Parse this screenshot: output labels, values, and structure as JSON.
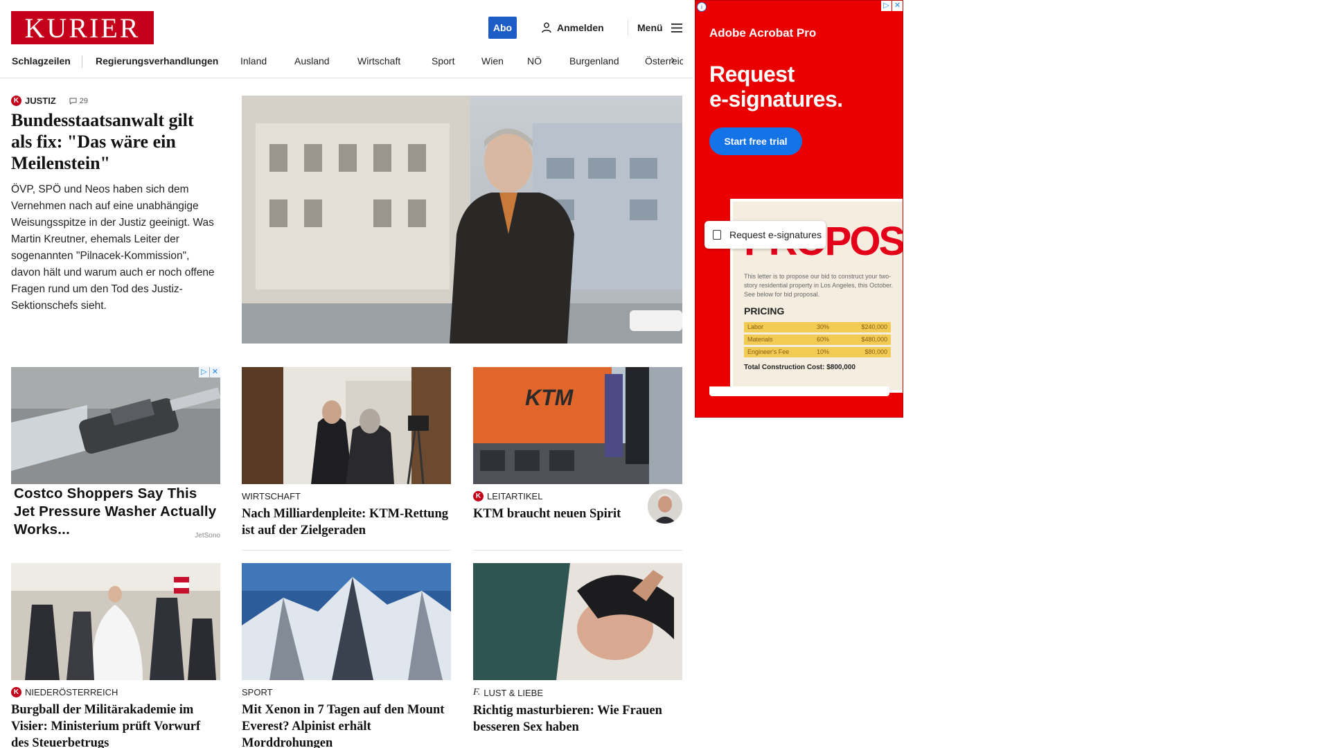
{
  "header": {
    "logo": "KURIER",
    "abo": "Abo",
    "login": "Anmelden",
    "menu": "Menü"
  },
  "nav": [
    "Schlagzeilen",
    "Regierungsverhandlungen",
    "Inland",
    "Ausland",
    "Wirtschaft",
    "Sport",
    "Wien",
    "NÖ",
    "Burgenland",
    "Österreich"
  ],
  "lead": {
    "category": "JUSTIZ",
    "comments": "29",
    "title": "Bundesstaatsanwalt gilt als fix: \"Das wäre ein Meilenstein\"",
    "text": "ÖVP, SPÖ und Neos haben sich dem Vernehmen nach auf eine unabhängige Weisungsspitze in der Justiz geeinigt. Was Martin Kreutner, ehemals Leiter der sogenannten \"Pilnacek-Kommission\", davon hält und warum auch er noch offene Fragen rund um den Tod des Justiz-Sektionschefs sieht."
  },
  "native_ad": {
    "title": "Costco Shoppers Say This Jet Pressure Washer Actually Works...",
    "source": "JetSono",
    "icon_labels": [
      "▷",
      "✕"
    ]
  },
  "cards_row1": [
    {
      "category": "WIRTSCHAFT",
      "title": "Nach Milliardenpleite: KTM-Rettung ist auf der Zielgeraden"
    },
    {
      "category": "LEITARTIKEL",
      "title": "KTM braucht neuen Spirit"
    }
  ],
  "cards_row2": [
    {
      "category": "NIEDERÖSTERREICH",
      "title": "Burgball der Militärakademie im Visier: Ministerium prüft Vorwurf des Steuerbetrugs"
    },
    {
      "category": "SPORT",
      "title": "Mit Xenon in 7 Tagen auf den Mount Everest? Alpinist erhält Morddrohungen"
    },
    {
      "category": "LUST & LIEBE",
      "title": "Richtig masturbieren: Wie Frauen besseren Sex haben"
    }
  ],
  "side_ad": {
    "brand": "Adobe Acrobat Pro",
    "headline_1": "Request",
    "headline_2": "e-signatures.",
    "cta": "Start free trial",
    "pill": "Request e-signatures",
    "doc_word": "PROPOSAL",
    "doc_text": "This letter is to propose our bid to construct your two-story residential property in Los Angeles, this October. See below for bid proposal.",
    "pricing_heading": "PRICING",
    "rows": [
      {
        "item": "Labor",
        "pct": "30%",
        "amount": "$240,000"
      },
      {
        "item": "Materials",
        "pct": "60%",
        "amount": "$480,000"
      },
      {
        "item": "Engineer's Fee",
        "pct": "10%",
        "amount": "$80,000"
      }
    ],
    "total": "Total Construction Cost: $800,000"
  },
  "colors": {
    "brand_red": "#c5001a",
    "abo_blue": "#1e5cc8",
    "ad_red": "#ea0000"
  }
}
